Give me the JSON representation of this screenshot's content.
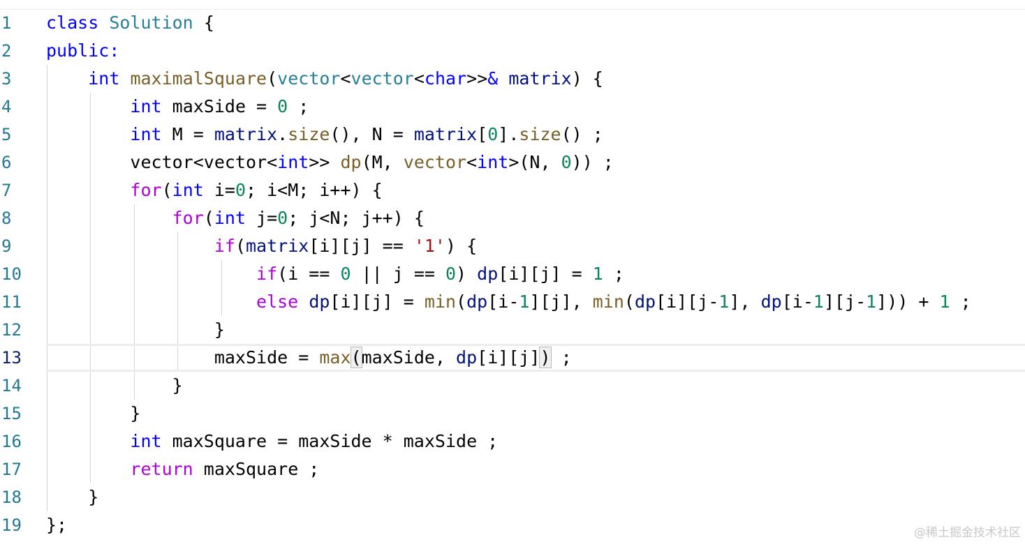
{
  "editor": {
    "lines": [
      {
        "n": "1"
      },
      {
        "n": "2"
      },
      {
        "n": "3"
      },
      {
        "n": "4"
      },
      {
        "n": "5"
      },
      {
        "n": "6"
      },
      {
        "n": "7"
      },
      {
        "n": "8"
      },
      {
        "n": "9"
      },
      {
        "n": "10"
      },
      {
        "n": "11"
      },
      {
        "n": "12"
      },
      {
        "n": "13"
      },
      {
        "n": "14"
      },
      {
        "n": "15"
      },
      {
        "n": "16"
      },
      {
        "n": "17"
      },
      {
        "n": "18"
      },
      {
        "n": "19"
      }
    ],
    "active_line": "13",
    "tokens": {
      "class_kw": "class",
      "class_name": "Solution",
      "lbrace": "{",
      "rbrace": "}",
      "public_kw": "public:",
      "int": "int",
      "char": "char",
      "vector": "vector",
      "maximalSquare": "maximalSquare",
      "matrix": "matrix",
      "maxSide": "maxSide",
      "maxSquare": "maxSquare",
      "zero": "0",
      "one": "1",
      "M": "M",
      "N": "N",
      "size": "size",
      "dp": "dp",
      "for": "for",
      "if": "if",
      "else": "else",
      "min": "min",
      "max": "max",
      "return": "return",
      "char_one": "'1'",
      "class_end": "};",
      "p3a": "(",
      "p3b": "<",
      "p3c": "<",
      "p3d": ">>",
      "p3e": "&",
      "p3f": ") {",
      "p4a": " = ",
      "p4b": " ;",
      "p5a": " M = ",
      "p5b": ".",
      "p5c": "(), N = ",
      "p5d": "[",
      "p5e": "].",
      "p5f": "() ;",
      "p6a": "vector<vector<",
      "p6b": ">> ",
      "p6c": "(M, ",
      "p6d": "<",
      "p6e": ">(N, ",
      "p6f": ")) ;",
      "p7a": "(",
      "p7b": " i=",
      "p7c": "; i<M; i++) {",
      "p8a": "(",
      "p8b": " j=",
      "p8c": "; j<N; j++) {",
      "p9a": "(",
      "p9b": "[i][j] == ",
      "p9c": ") {",
      "p10a": "(i == ",
      "p10b": " || j == ",
      "p10c": ") ",
      "p10d": "[i][j] = ",
      "p10e": " ;",
      "p11a": " ",
      "p11b": "[i][j] = ",
      "p11c": "(",
      "p11d": "[i-",
      "p11e": "][j], ",
      "p11f": "(",
      "p11g": "[i][j-",
      "p11h": "], ",
      "p11i": "[i-",
      "p11j": "][j-",
      "p11k": "])) + ",
      "p11l": " ;",
      "p13a": " = ",
      "p13b": "(",
      "p13c": ", ",
      "p13d": "[i][j]",
      "p13e": ")",
      "p13f": " ;",
      "p16a": " maxSquare = maxSide * maxSide ;",
      "p17a": " maxSquare ;"
    }
  },
  "watermark": "@稀土掘金技术社区"
}
